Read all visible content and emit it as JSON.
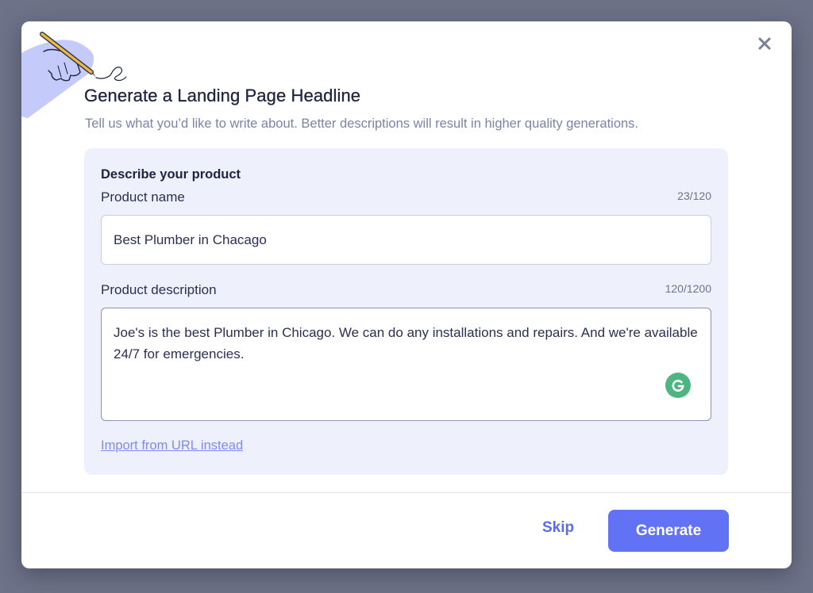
{
  "modal": {
    "title": "Generate a Landing Page Headline",
    "subtitle": "Tell us what you’d like to write about. Better descriptions will result in higher quality generations."
  },
  "form": {
    "section_heading": "Describe your product",
    "product_name": {
      "label": "Product name",
      "count": "23/120",
      "value": "Best Plumber in Chacago"
    },
    "product_description": {
      "label": "Product description",
      "count": "120/1200",
      "value": "Joe's is the best Plumber in Chicago. We can do any installations and repairs. And we're available 24/7 for emergencies."
    },
    "import_link": "Import from URL instead"
  },
  "footer": {
    "skip_label": "Skip",
    "generate_label": "Generate"
  },
  "icons": {
    "close": "close-icon",
    "grammarly": "grammarly-icon",
    "illustration": "hand-writing-pencil-illustration"
  },
  "colors": {
    "overlay": "#6e7288",
    "accent": "#6272f5",
    "link": "#7e8af5",
    "form_card": "#eef0fc",
    "grammarly": "#4cb580",
    "illustration_bg": "#c4cbfa"
  }
}
